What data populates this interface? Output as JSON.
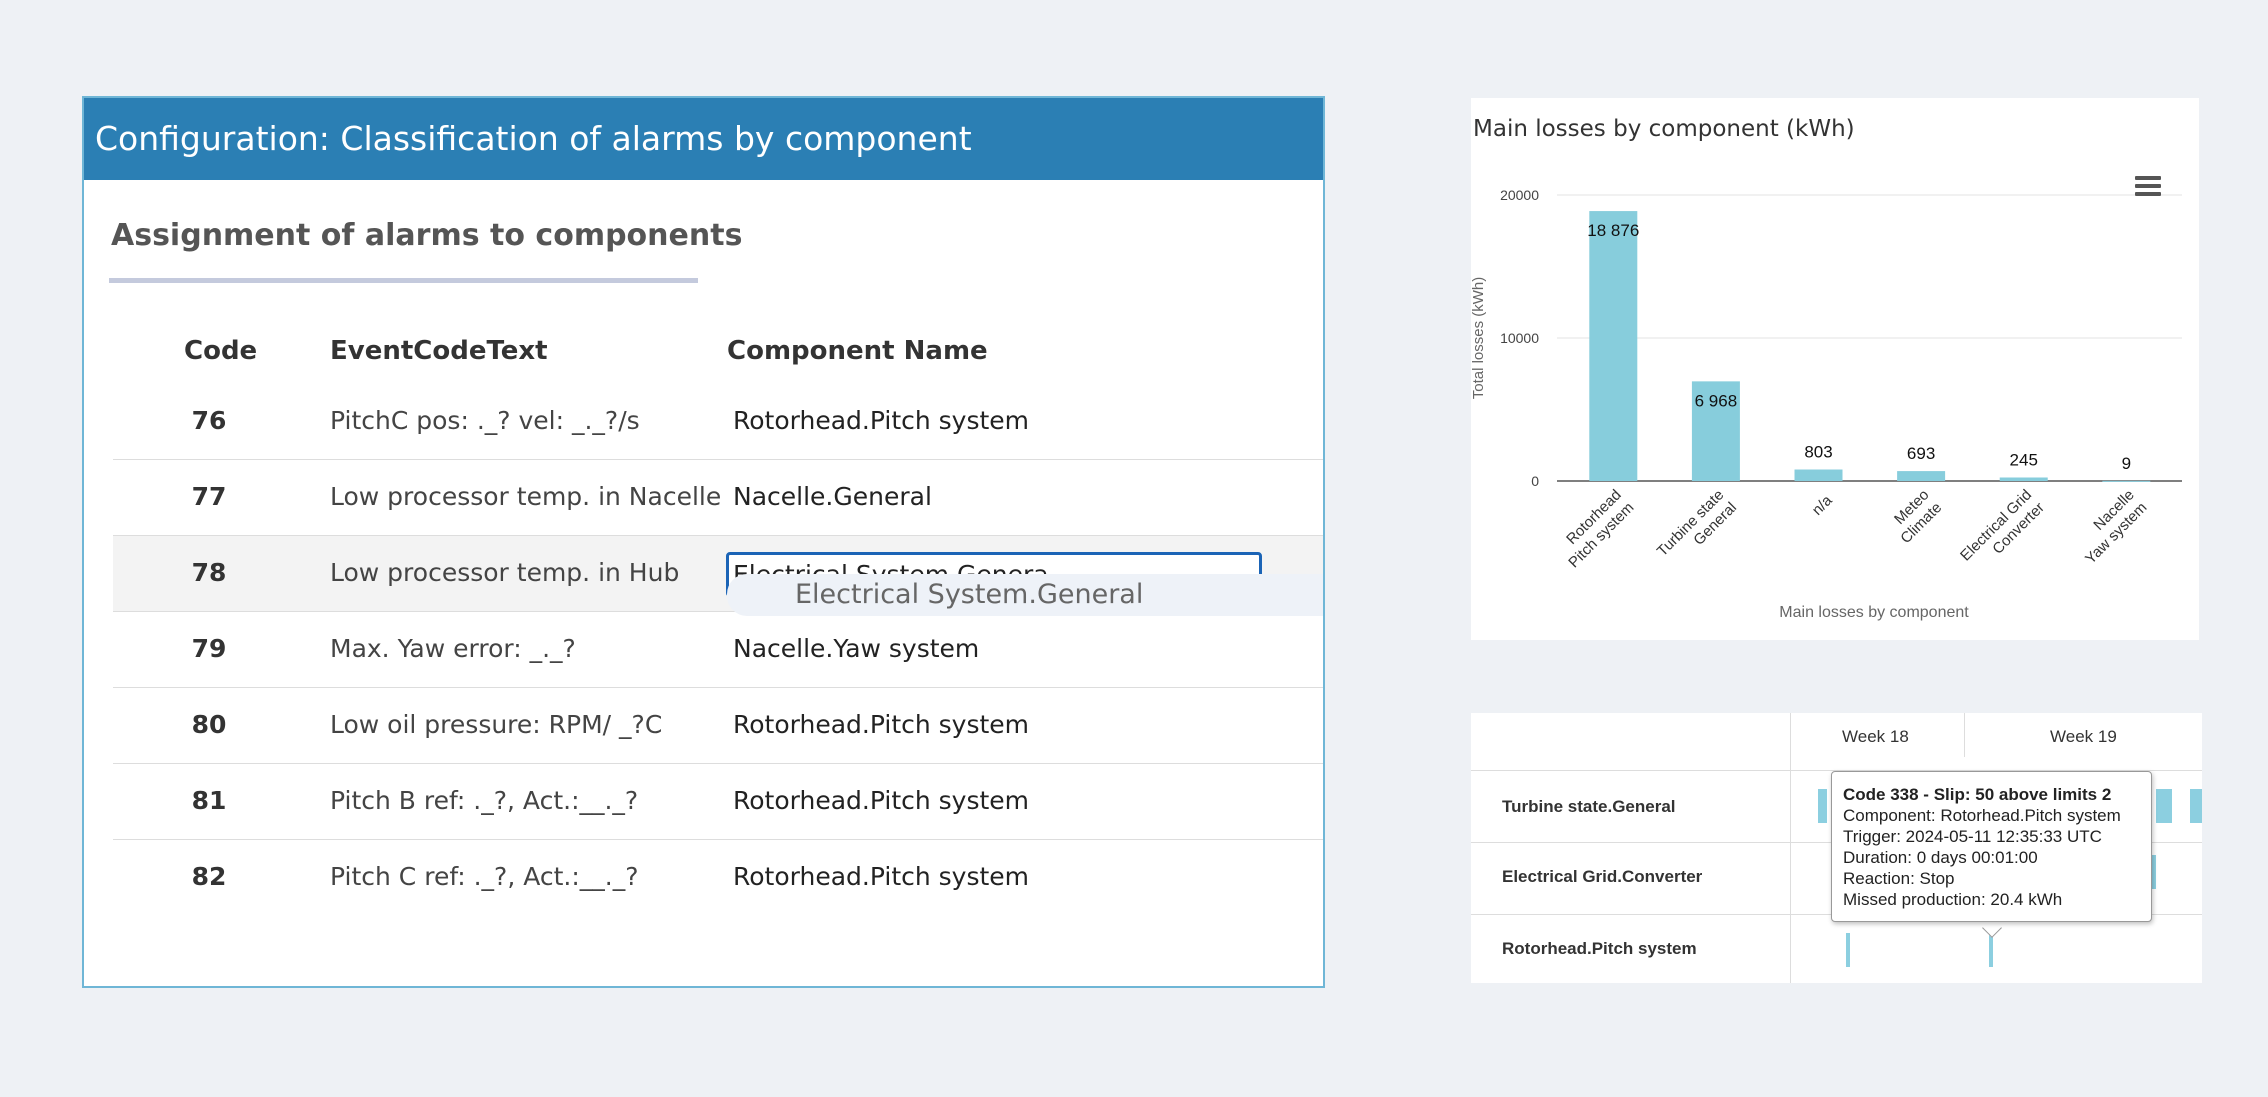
{
  "config": {
    "header_title": "Configuration: Classification of alarms by component",
    "section_title": "Assignment of alarms to components",
    "columns": {
      "code": "Code",
      "text": "EventCodeText",
      "component": "Component Name"
    },
    "rows": [
      {
        "code": "76",
        "text": "PitchC pos:  ._? vel:  _._?/s",
        "component": "Rotorhead.Pitch system"
      },
      {
        "code": "77",
        "text": "Low processor temp. in Nacelle",
        "component": "Nacelle.General"
      },
      {
        "code": "78",
        "text": "Low processor temp. in Hub",
        "component": "Electrical System.Genera",
        "editing": true
      },
      {
        "code": "79",
        "text": "Max. Yaw error:   _._?",
        "component": "Nacelle.Yaw system"
      },
      {
        "code": "80",
        "text": "Low oil pressure:      RPM/  _?C",
        "component": "Rotorhead.Pitch system"
      },
      {
        "code": "81",
        "text": "Pitch B ref:  ._?, Act.:__._?",
        "component": "Rotorhead.Pitch system"
      },
      {
        "code": "82",
        "text": "Pitch C ref:  ._?, Act.:__._?",
        "component": "Rotorhead.Pitch system"
      }
    ],
    "suggestion": "Electrical System.General",
    "colors": {
      "header": "#2b7fb4",
      "input_border": "#1b64b6"
    }
  },
  "chart_data": {
    "type": "bar",
    "title": "Main losses by component (kWh)",
    "xlabel": "Main losses by component",
    "ylabel": "Total losses (kWh)",
    "categories": [
      [
        "Rotorhead",
        "Pitch system"
      ],
      [
        "Turbine state",
        "General"
      ],
      [
        "n/a"
      ],
      [
        "Meteo",
        "Climate"
      ],
      [
        "Electrical Grid",
        "Converter"
      ],
      [
        "Nacelle",
        "Yaw system"
      ]
    ],
    "values": [
      18876,
      6968,
      803,
      693,
      245,
      9
    ],
    "value_labels": [
      "18 876",
      "6 968",
      "803",
      "693",
      "245",
      "9"
    ],
    "yticks": [
      "0",
      "10000",
      "20000"
    ],
    "ylim": [
      0,
      20000
    ],
    "grid": true,
    "bar_color": "#87cddc"
  },
  "timeline": {
    "weeks": [
      "Week 18",
      "Week 19"
    ],
    "rows": [
      "Turbine state.General",
      "Electrical Grid.Converter",
      "Rotorhead.Pitch system"
    ],
    "tooltip": {
      "title": "Code 338 - Slip: 50 above limits 2",
      "component": "Component: Rotorhead.Pitch system",
      "trigger": "Trigger: 2024-05-11 12:35:33 UTC",
      "duration": "Duration: 0 days 00:01:00",
      "reaction": "Reaction: Stop",
      "missed": "Missed production: 20.4 kWh"
    }
  }
}
